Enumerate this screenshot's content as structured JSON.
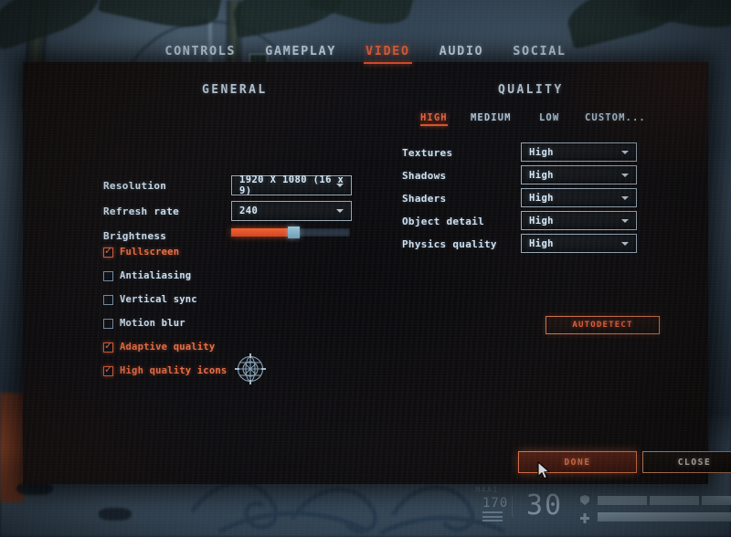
{
  "tabs": [
    {
      "label": "CONTROLS",
      "active": false
    },
    {
      "label": "GAMEPLAY",
      "active": false
    },
    {
      "label": "VIDEO",
      "active": true
    },
    {
      "label": "AUDIO",
      "active": false
    },
    {
      "label": "SOCIAL",
      "active": false
    }
  ],
  "general": {
    "title": "GENERAL",
    "resolution": {
      "label": "Resolution",
      "value": "1920 X 1080 (16 x 9)"
    },
    "refresh_rate": {
      "label": "Refresh rate",
      "value": "240"
    },
    "brightness": {
      "label": "Brightness",
      "value": 52
    },
    "checkboxes": [
      {
        "label": "Fullscreen",
        "checked": true
      },
      {
        "label": "Antialiasing",
        "checked": false
      },
      {
        "label": "Vertical sync",
        "checked": false
      },
      {
        "label": "Motion blur",
        "checked": false
      },
      {
        "label": "Adaptive quality",
        "checked": true
      },
      {
        "label": "High quality icons",
        "checked": true
      }
    ]
  },
  "quality": {
    "title": "QUALITY",
    "presets": [
      {
        "label": "HIGH",
        "active": true
      },
      {
        "label": "MEDIUM",
        "active": false
      },
      {
        "label": "LOW",
        "active": false
      },
      {
        "label": "CUSTOM...",
        "active": false
      }
    ],
    "rows": [
      {
        "label": "Textures",
        "value": "High"
      },
      {
        "label": "Shadows",
        "value": "High"
      },
      {
        "label": "Shaders",
        "value": "High"
      },
      {
        "label": "Object detail",
        "value": "High"
      },
      {
        "label": "Physics quality",
        "value": "High"
      }
    ],
    "autodetect_label": "AUTODETECT"
  },
  "footer": {
    "done_label": "DONE",
    "close_label": "CLOSE"
  },
  "hud": {
    "weapon": "M4A1",
    "reserve_ammo": "170",
    "magazine_ammo": "30"
  },
  "colors": {
    "accent_orange": "#e8623a",
    "text_blue": "#cfe0ee",
    "dropdown_border": "#97a9b8",
    "slider_fill": "#f2612f"
  }
}
